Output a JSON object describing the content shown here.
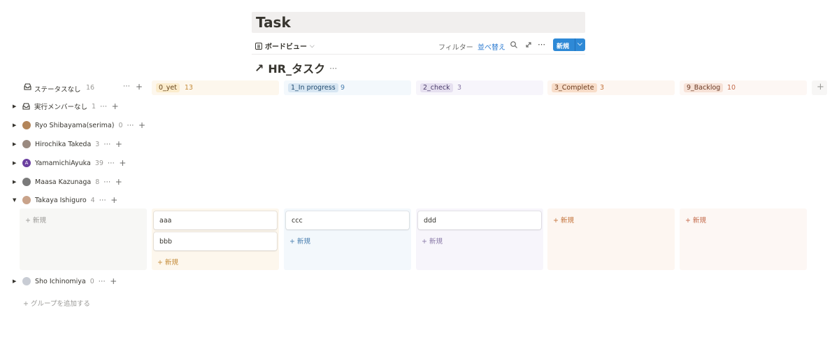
{
  "page": {
    "title": "Task"
  },
  "toolbar": {
    "view_label": "ボードビュー",
    "view_chevron": "⌵",
    "filter": "フィルター",
    "sort": "並べ替え",
    "search_icon": "search-icon",
    "expand_icon": "expand-icon",
    "more_icon": "⋯",
    "new_label": "新規",
    "new_chevron": "⌵"
  },
  "database": {
    "arrow": "↗",
    "title": "HR_タスク",
    "more": "⋯"
  },
  "columns": [
    {
      "label": "ステータスなし",
      "count": "16",
      "bg": "#ffffff",
      "tag_bg": "transparent",
      "tag_color": "#37352f"
    },
    {
      "label": "0_yet",
      "count": "13",
      "bg": "#fdf7ed",
      "tag_bg": "#fbeccc",
      "tag_color": "#67451b",
      "count_color": "#c58c3a"
    },
    {
      "label": "1_In progress",
      "count": "9",
      "bg": "#f3f8fc",
      "tag_bg": "#d7e6f2",
      "tag_color": "#1e4a70",
      "count_color": "#4a7fb0"
    },
    {
      "label": "2_check",
      "count": "3",
      "bg": "#f7f5fb",
      "tag_bg": "#e6e0f0",
      "tag_color": "#4b3c6b",
      "count_color": "#8a7aa8"
    },
    {
      "label": "3_Complete",
      "count": "3",
      "bg": "#fdf6f1",
      "tag_bg": "#f8ddc9",
      "tag_color": "#6b3a1c",
      "count_color": "#c4733b"
    },
    {
      "label": "9_Backlog",
      "count": "10",
      "bg": "#fdf7f4",
      "tag_bg": "#f7e2d7",
      "tag_color": "#6b3a24",
      "count_color": "#c46b4b"
    }
  ],
  "add_column": "+",
  "groups": [
    {
      "name": "実行メンバーなし",
      "count": "1",
      "avatar": "inbox-icon",
      "expanded": false
    },
    {
      "name": "Ryo Shibayama(serima)",
      "count": "0",
      "avatar": "#b3855a",
      "expanded": false
    },
    {
      "name": "Hirochika Takeda",
      "count": "3",
      "avatar": "#9a8a80",
      "expanded": false
    },
    {
      "name": "YamamichiAyuka",
      "count": "39",
      "avatar": "#6b3fa0",
      "avatar_letter": "A",
      "expanded": false
    },
    {
      "name": "Maasa Kazunaga",
      "count": "8",
      "avatar": "#7a7a7a",
      "expanded": false
    },
    {
      "name": "Takaya Ishiguro",
      "count": "4",
      "avatar": "#c9a38a",
      "expanded": true
    },
    {
      "name": "Sho Ichinomiya",
      "count": "0",
      "avatar": "#c8ccd4",
      "expanded": false
    }
  ],
  "row_actions": {
    "more": "⋯",
    "add": "+"
  },
  "lanes": {
    "none_add": "+ 新規",
    "yet_cards": [
      "aaa",
      "bbb"
    ],
    "yet_add": "+ 新規",
    "progress_cards": [
      "ccc"
    ],
    "progress_add": "+ 新規",
    "check_cards": [
      "ddd"
    ],
    "check_add": "+ 新規",
    "complete_add": "+ 新規",
    "backlog_add": "+ 新規"
  },
  "add_group": "+ グループを追加する"
}
